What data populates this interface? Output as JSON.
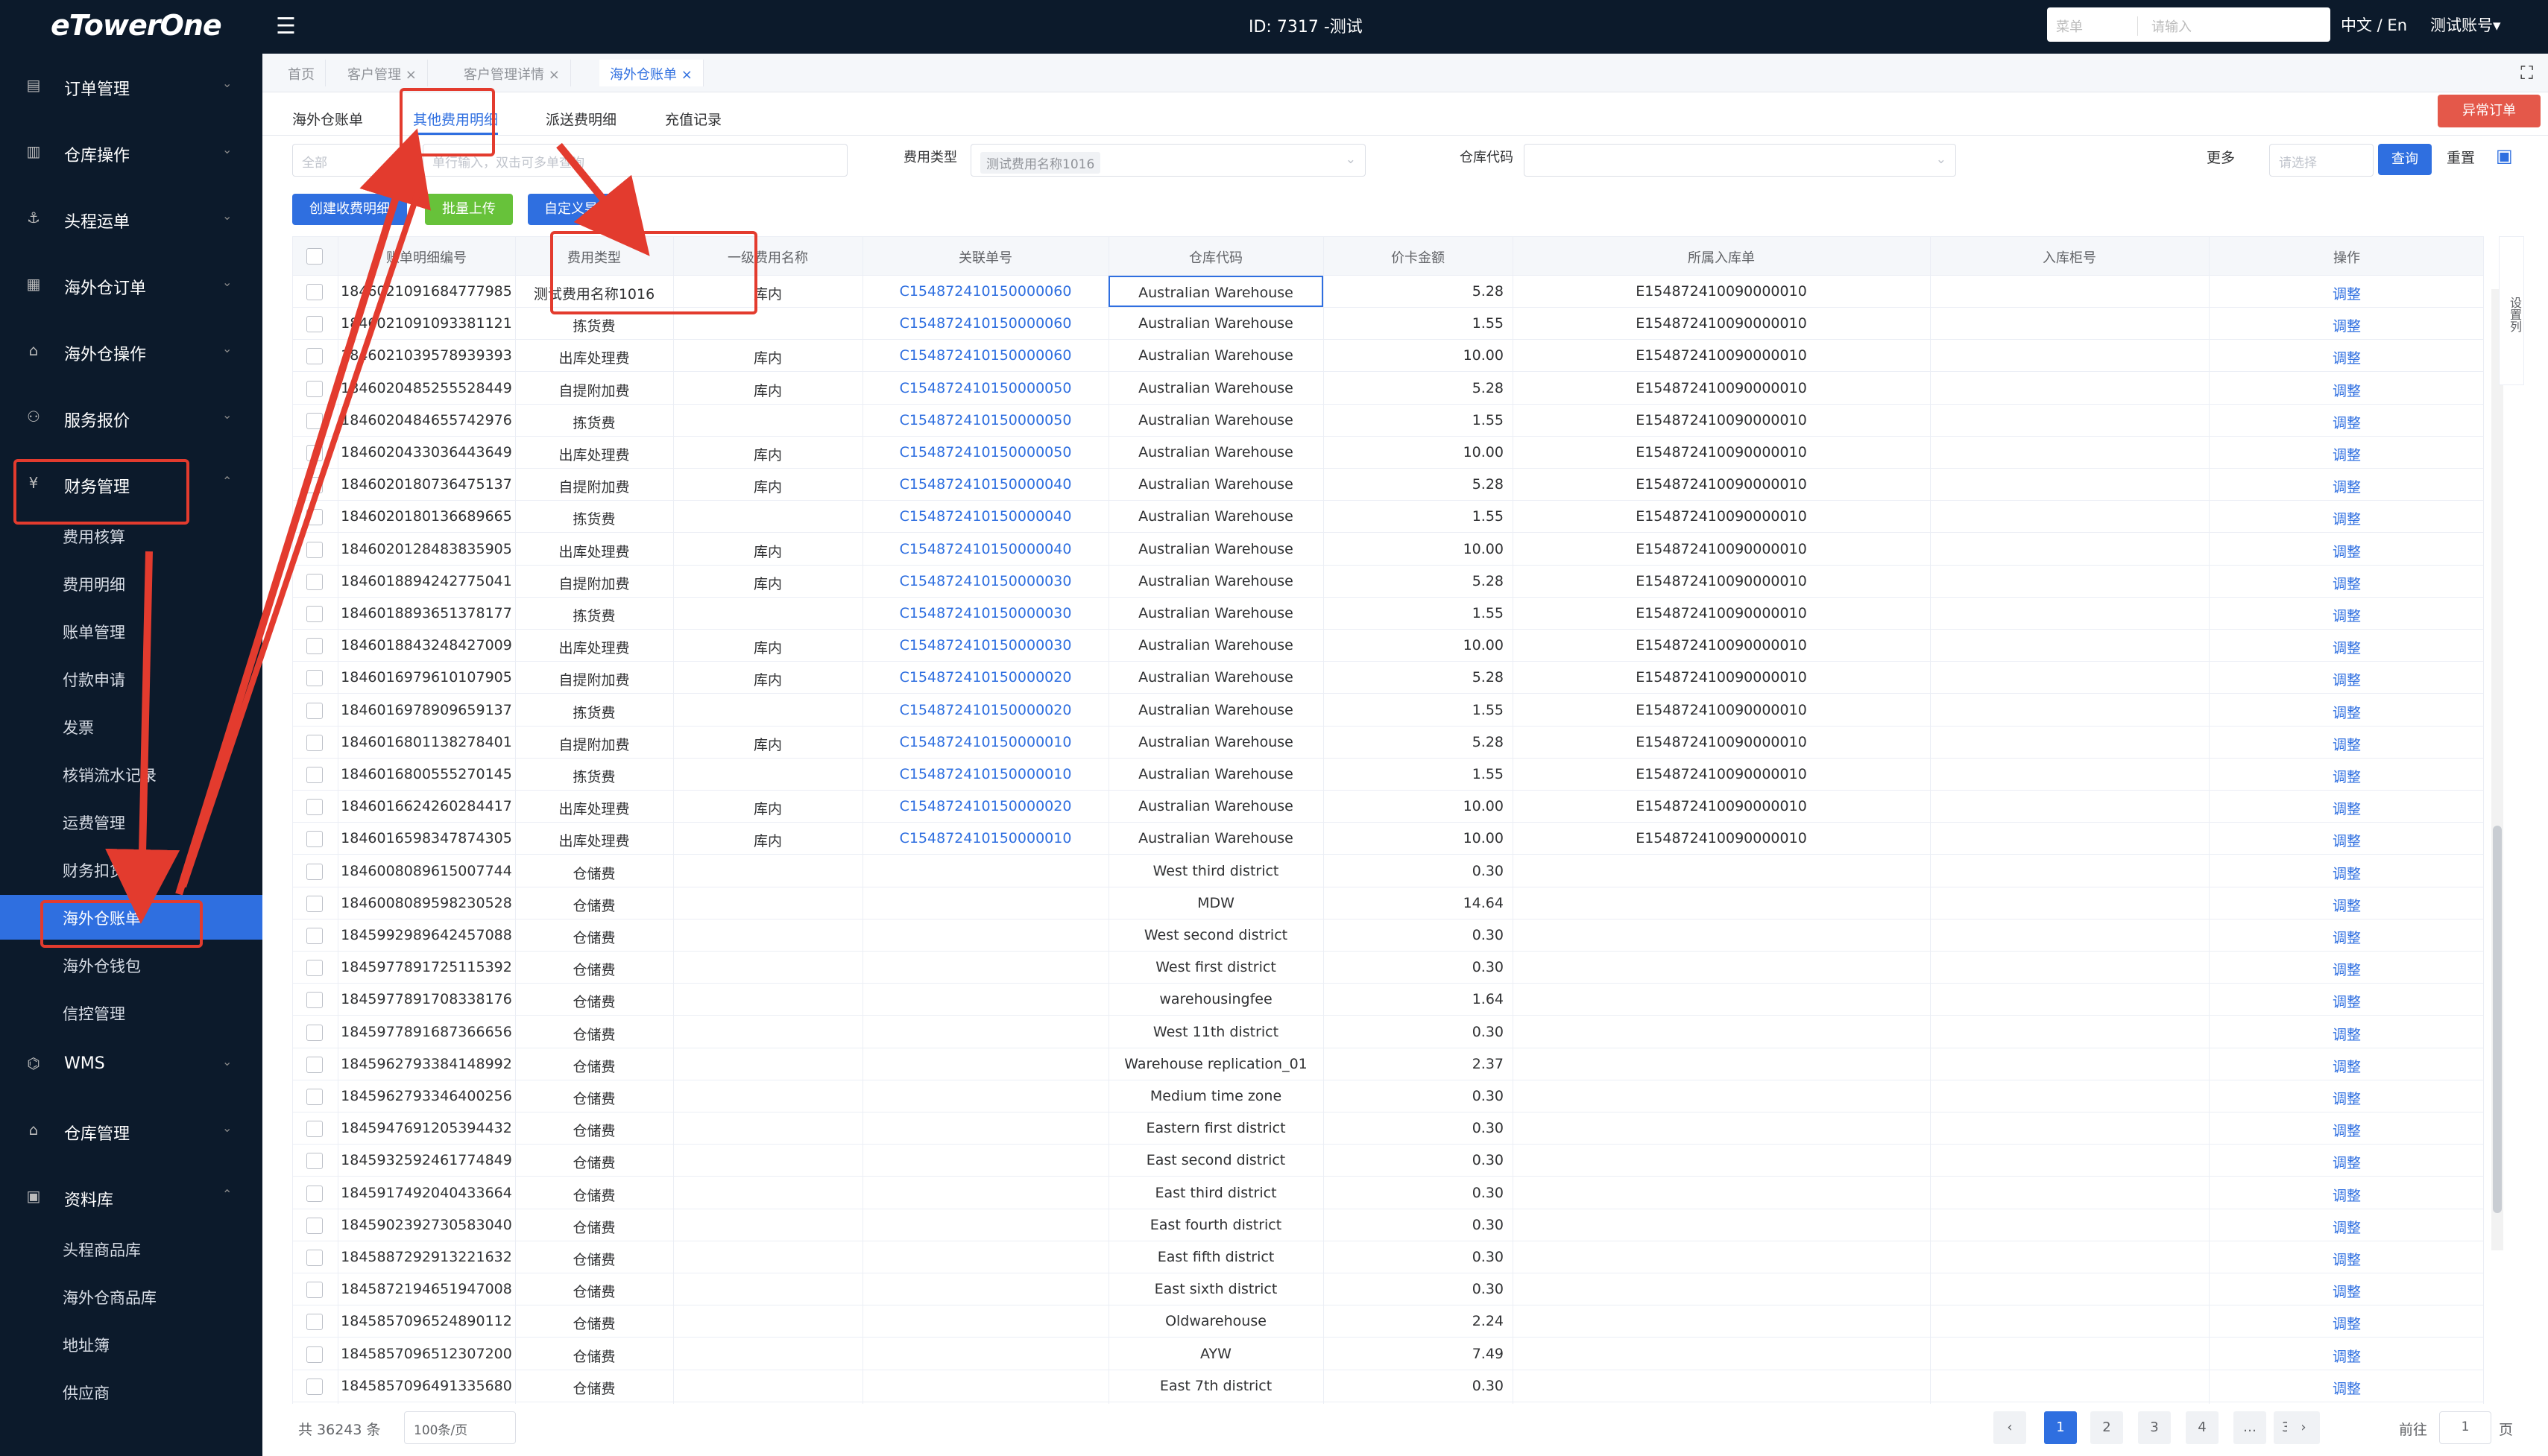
{
  "topbar": {
    "logo": "eTowerOne",
    "title": "ID: 7317 -测试",
    "menu_select": "菜单",
    "menu_search_placeholder": "请输入",
    "language": "中文 / En",
    "account": "测试账号▾"
  },
  "sidebar": {
    "groups": [
      {
        "label": "订单管理",
        "icon": "order-icon"
      },
      {
        "label": "仓库操作",
        "icon": "warehouse-op-icon"
      },
      {
        "label": "头程运单",
        "icon": "waybill-icon"
      },
      {
        "label": "海外仓订单",
        "icon": "overseas-order-icon"
      },
      {
        "label": "海外仓操作",
        "icon": "overseas-op-icon"
      },
      {
        "label": "服务报价",
        "icon": "quote-icon"
      },
      {
        "label": "财务管理",
        "icon": "finance-icon"
      }
    ],
    "finance_items": [
      "费用核算",
      "费用明细",
      "账单管理",
      "付款申请",
      "发票",
      "核销流水记录",
      "运费管理",
      "财务扣货",
      "海外仓账单",
      "海外仓钱包",
      "信控管理"
    ],
    "groups2": [
      {
        "label": "WMS",
        "icon": "wms-icon"
      },
      {
        "label": "仓库管理",
        "icon": "warehouse-mgmt-icon"
      },
      {
        "label": "资料库",
        "icon": "database-icon"
      }
    ],
    "library_items": [
      "头程商品库",
      "海外仓商品库",
      "地址簿",
      "供应商"
    ]
  },
  "tabs": [
    "首页",
    "客户管理",
    "客户管理详情",
    "海外仓账单"
  ],
  "subtabs": [
    "海外仓账单",
    "其他费用明细",
    "派送费明细",
    "充值记录"
  ],
  "abnormal_button": "异常订单",
  "filters": {
    "scope": "全部",
    "search_placeholder": "单行输入，双击可多单查询",
    "fee_type_label": "费用类型",
    "fee_type_value": "测试费用名称1016",
    "warehouse_label": "仓库代码",
    "more": "更多",
    "more_placeholder": "请选择",
    "query": "查询",
    "reset": "重置"
  },
  "actions": {
    "create": "创建收费明细",
    "upload": "批量上传",
    "export": "自定义导出"
  },
  "columns": [
    "账单明细编号",
    "费用类型",
    "一级费用名称",
    "关联单号",
    "仓库代码",
    "价卡金额",
    "所属入库单",
    "入库柜号",
    "操作"
  ],
  "column_setting": "设置列",
  "rows": [
    [
      "1846021091684777985",
      "测试费用名称1016",
      "库内",
      "C154872410150000060",
      "Australian Warehouse",
      "5.28",
      "E154872410090000010",
      "",
      "调整"
    ],
    [
      "1846021091093381121",
      "拣货费",
      "",
      "C154872410150000060",
      "Australian Warehouse",
      "1.55",
      "E154872410090000010",
      "",
      "调整"
    ],
    [
      "1846021039578939393",
      "出库处理费",
      "库内",
      "C154872410150000060",
      "Australian Warehouse",
      "10.00",
      "E154872410090000010",
      "",
      "调整"
    ],
    [
      "1846020485255528449",
      "自提附加费",
      "库内",
      "C154872410150000050",
      "Australian Warehouse",
      "5.28",
      "E154872410090000010",
      "",
      "调整"
    ],
    [
      "1846020484655742976",
      "拣货费",
      "",
      "C154872410150000050",
      "Australian Warehouse",
      "1.55",
      "E154872410090000010",
      "",
      "调整"
    ],
    [
      "1846020433036443649",
      "出库处理费",
      "库内",
      "C154872410150000050",
      "Australian Warehouse",
      "10.00",
      "E154872410090000010",
      "",
      "调整"
    ],
    [
      "1846020180736475137",
      "自提附加费",
      "库内",
      "C154872410150000040",
      "Australian Warehouse",
      "5.28",
      "E154872410090000010",
      "",
      "调整"
    ],
    [
      "1846020180136689665",
      "拣货费",
      "",
      "C154872410150000040",
      "Australian Warehouse",
      "1.55",
      "E154872410090000010",
      "",
      "调整"
    ],
    [
      "1846020128483835905",
      "出库处理费",
      "库内",
      "C154872410150000040",
      "Australian Warehouse",
      "10.00",
      "E154872410090000010",
      "",
      "调整"
    ],
    [
      "1846018894242775041",
      "自提附加费",
      "库内",
      "C154872410150000030",
      "Australian Warehouse",
      "5.28",
      "E154872410090000010",
      "",
      "调整"
    ],
    [
      "1846018893651378177",
      "拣货费",
      "",
      "C154872410150000030",
      "Australian Warehouse",
      "1.55",
      "E154872410090000010",
      "",
      "调整"
    ],
    [
      "1846018843248427009",
      "出库处理费",
      "库内",
      "C154872410150000030",
      "Australian Warehouse",
      "10.00",
      "E154872410090000010",
      "",
      "调整"
    ],
    [
      "1846016979610107905",
      "自提附加费",
      "库内",
      "C154872410150000020",
      "Australian Warehouse",
      "5.28",
      "E154872410090000010",
      "",
      "调整"
    ],
    [
      "1846016978909659137",
      "拣货费",
      "",
      "C154872410150000020",
      "Australian Warehouse",
      "1.55",
      "E154872410090000010",
      "",
      "调整"
    ],
    [
      "1846016801138278401",
      "自提附加费",
      "库内",
      "C154872410150000010",
      "Australian Warehouse",
      "5.28",
      "E154872410090000010",
      "",
      "调整"
    ],
    [
      "1846016800555270145",
      "拣货费",
      "",
      "C154872410150000010",
      "Australian Warehouse",
      "1.55",
      "E154872410090000010",
      "",
      "调整"
    ],
    [
      "1846016624260284417",
      "出库处理费",
      "库内",
      "C154872410150000020",
      "Australian Warehouse",
      "10.00",
      "E154872410090000010",
      "",
      "调整"
    ],
    [
      "1846016598347874305",
      "出库处理费",
      "库内",
      "C154872410150000010",
      "Australian Warehouse",
      "10.00",
      "E154872410090000010",
      "",
      "调整"
    ],
    [
      "1846008089615007744",
      "仓储费",
      "",
      "",
      "West third district",
      "0.30",
      "",
      "",
      "调整"
    ],
    [
      "1846008089598230528",
      "仓储费",
      "",
      "",
      "MDW",
      "14.64",
      "",
      "",
      "调整"
    ],
    [
      "1845992989642457088",
      "仓储费",
      "",
      "",
      "West second district",
      "0.30",
      "",
      "",
      "调整"
    ],
    [
      "1845977891725115392",
      "仓储费",
      "",
      "",
      "West first district",
      "0.30",
      "",
      "",
      "调整"
    ],
    [
      "1845977891708338176",
      "仓储费",
      "",
      "",
      "warehousingfee",
      "1.64",
      "",
      "",
      "调整"
    ],
    [
      "1845977891687366656",
      "仓储费",
      "",
      "",
      "West 11th district",
      "0.30",
      "",
      "",
      "调整"
    ],
    [
      "1845962793384148992",
      "仓储费",
      "",
      "",
      "Warehouse replication_01",
      "2.37",
      "",
      "",
      "调整"
    ],
    [
      "1845962793346400256",
      "仓储费",
      "",
      "",
      "Medium time zone",
      "0.30",
      "",
      "",
      "调整"
    ],
    [
      "1845947691205394432",
      "仓储费",
      "",
      "",
      "Eastern first district",
      "0.30",
      "",
      "",
      "调整"
    ],
    [
      "1845932592461774849",
      "仓储费",
      "",
      "",
      "East second district",
      "0.30",
      "",
      "",
      "调整"
    ],
    [
      "1845917492040433664",
      "仓储费",
      "",
      "",
      "East third district",
      "0.30",
      "",
      "",
      "调整"
    ],
    [
      "1845902392730583040",
      "仓储费",
      "",
      "",
      "East fourth district",
      "0.30",
      "",
      "",
      "调整"
    ],
    [
      "1845887292913221632",
      "仓储费",
      "",
      "",
      "East fifth district",
      "0.30",
      "",
      "",
      "调整"
    ],
    [
      "1845872194651947008",
      "仓储费",
      "",
      "",
      "East sixth district",
      "0.30",
      "",
      "",
      "调整"
    ],
    [
      "1845857096524890112",
      "仓储费",
      "",
      "",
      "Oldwarehouse",
      "2.24",
      "",
      "",
      "调整"
    ],
    [
      "1845857096512307200",
      "仓储费",
      "",
      "",
      "AYW",
      "7.49",
      "",
      "",
      "调整"
    ],
    [
      "1845857096491335680",
      "仓储费",
      "",
      "",
      "East 7th district",
      "0.30",
      "",
      "",
      "调整"
    ]
  ],
  "pagination": {
    "total": "共 36243 条",
    "page_size": "100条/页",
    "pages": [
      "1",
      "2",
      "3",
      "4",
      "…",
      "363"
    ],
    "current": "1",
    "goto_label": "前往",
    "goto_value": "1",
    "goto_suffix": "页"
  },
  "colors": {
    "accent": "#2f6fe0",
    "sidebar": "#0c1a2b",
    "annotation": "#e33b2e"
  }
}
